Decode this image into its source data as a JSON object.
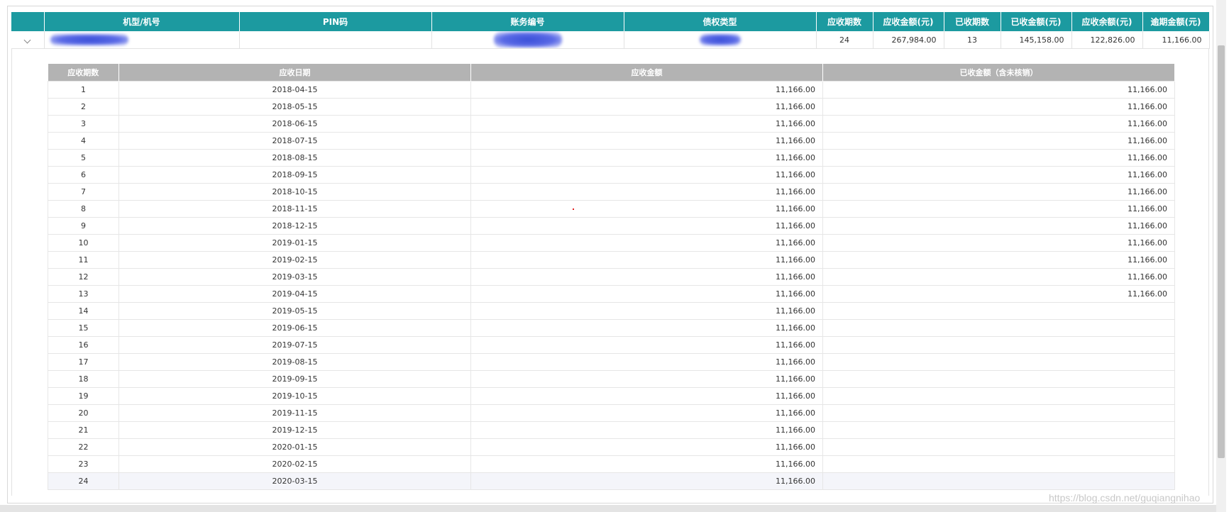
{
  "main_table": {
    "headers": [
      "机型/机号",
      "PIN码",
      "账务编号",
      "债权类型",
      "应收期数",
      "应收金额(元)",
      "已收期数",
      "已收金额(元)",
      "应收余额(元)",
      "逾期金额(元)"
    ],
    "row": {
      "model_number": "",
      "pin": "",
      "account_no": "",
      "claim_type": "",
      "receivable_periods": "24",
      "receivable_amount": "267,984.00",
      "received_periods": "13",
      "received_amount": "145,158.00",
      "receivable_balance": "122,826.00",
      "overdue_amount": "11,166.00"
    }
  },
  "detail_table": {
    "headers": [
      "应收期数",
      "应收日期",
      "应收金额",
      "已收金额（含未核销）"
    ],
    "rows": [
      {
        "period": "1",
        "date": "2018-04-15",
        "amount": "11,166.00",
        "received": "11,166.00"
      },
      {
        "period": "2",
        "date": "2018-05-15",
        "amount": "11,166.00",
        "received": "11,166.00"
      },
      {
        "period": "3",
        "date": "2018-06-15",
        "amount": "11,166.00",
        "received": "11,166.00"
      },
      {
        "period": "4",
        "date": "2018-07-15",
        "amount": "11,166.00",
        "received": "11,166.00"
      },
      {
        "period": "5",
        "date": "2018-08-15",
        "amount": "11,166.00",
        "received": "11,166.00"
      },
      {
        "period": "6",
        "date": "2018-09-15",
        "amount": "11,166.00",
        "received": "11,166.00"
      },
      {
        "period": "7",
        "date": "2018-10-15",
        "amount": "11,166.00",
        "received": "11,166.00"
      },
      {
        "period": "8",
        "date": "2018-11-15",
        "amount": "11,166.00",
        "received": "11,166.00"
      },
      {
        "period": "9",
        "date": "2018-12-15",
        "amount": "11,166.00",
        "received": "11,166.00"
      },
      {
        "period": "10",
        "date": "2019-01-15",
        "amount": "11,166.00",
        "received": "11,166.00"
      },
      {
        "period": "11",
        "date": "2019-02-15",
        "amount": "11,166.00",
        "received": "11,166.00"
      },
      {
        "period": "12",
        "date": "2019-03-15",
        "amount": "11,166.00",
        "received": "11,166.00"
      },
      {
        "period": "13",
        "date": "2019-04-15",
        "amount": "11,166.00",
        "received": "11,166.00"
      },
      {
        "period": "14",
        "date": "2019-05-15",
        "amount": "11,166.00",
        "received": ""
      },
      {
        "period": "15",
        "date": "2019-06-15",
        "amount": "11,166.00",
        "received": ""
      },
      {
        "period": "16",
        "date": "2019-07-15",
        "amount": "11,166.00",
        "received": ""
      },
      {
        "period": "17",
        "date": "2019-08-15",
        "amount": "11,166.00",
        "received": ""
      },
      {
        "period": "18",
        "date": "2019-09-15",
        "amount": "11,166.00",
        "received": ""
      },
      {
        "period": "19",
        "date": "2019-10-15",
        "amount": "11,166.00",
        "received": ""
      },
      {
        "period": "20",
        "date": "2019-11-15",
        "amount": "11,166.00",
        "received": ""
      },
      {
        "period": "21",
        "date": "2019-12-15",
        "amount": "11,166.00",
        "received": ""
      },
      {
        "period": "22",
        "date": "2020-01-15",
        "amount": "11,166.00",
        "received": ""
      },
      {
        "period": "23",
        "date": "2020-02-15",
        "amount": "11,166.00",
        "received": ""
      },
      {
        "period": "24",
        "date": "2020-03-15",
        "amount": "11,166.00",
        "received": ""
      }
    ]
  },
  "watermark": "https://blog.csdn.net/guqiangnihao",
  "colors": {
    "header_teal": "#1c9aa0",
    "sub_header_gray": "#b3b3b3",
    "redacted_blue": "#3a4fd8"
  },
  "icons": {
    "expand": "chevron-down-icon"
  }
}
